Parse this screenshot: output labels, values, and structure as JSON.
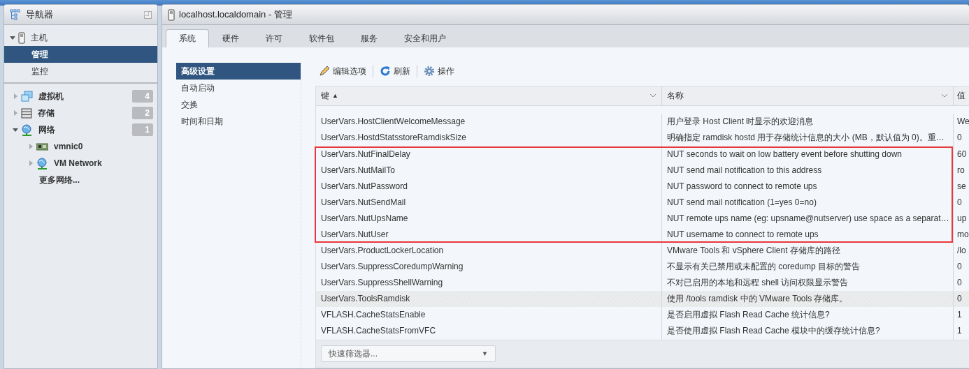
{
  "navigator": {
    "title": "导航器",
    "host": {
      "label": "主机",
      "expanded": true,
      "children": [
        {
          "label": "管理",
          "selected": true
        },
        {
          "label": "监控",
          "selected": false
        }
      ]
    },
    "inventory": [
      {
        "label": "虚拟机",
        "kind": "vm",
        "count": "4",
        "expanded": false
      },
      {
        "label": "存储",
        "kind": "storage",
        "count": "2",
        "expanded": false
      },
      {
        "label": "网络",
        "kind": "network",
        "count": "1",
        "expanded": true,
        "children": [
          {
            "label": "vmnic0",
            "kind": "nic",
            "expanded": false
          },
          {
            "label": "VM Network",
            "kind": "network",
            "expanded": false
          },
          {
            "label": "更多网络...",
            "kind": "more"
          }
        ]
      }
    ]
  },
  "main": {
    "title": "localhost.localdomain - 管理",
    "tabs": [
      {
        "label": "系统",
        "selected": true
      },
      {
        "label": "硬件",
        "selected": false
      },
      {
        "label": "许可",
        "selected": false
      },
      {
        "label": "软件包",
        "selected": false
      },
      {
        "label": "服务",
        "selected": false
      },
      {
        "label": "安全和用户",
        "selected": false
      }
    ],
    "side_menu": [
      {
        "label": "高级设置",
        "selected": true
      },
      {
        "label": "自动启动",
        "selected": false
      },
      {
        "label": "交换",
        "selected": false
      },
      {
        "label": "时间和日期",
        "selected": false
      }
    ],
    "toolbar": [
      {
        "label": "编辑选项",
        "kind": "edit"
      },
      {
        "label": "刷新",
        "kind": "refresh"
      },
      {
        "label": "操作",
        "kind": "actions"
      }
    ],
    "table": {
      "columns": [
        {
          "label": "键",
          "sort": "▲"
        },
        {
          "label": "名称"
        },
        {
          "label": "值"
        }
      ],
      "rows": [
        {
          "key": "UserVars.HostClientWelcomeMessage",
          "name": "用户登录 Host Client 时显示的欢迎消息",
          "value": "We",
          "selected": false,
          "highlighted": false
        },
        {
          "key": "UserVars.HostdStatsstoreRamdiskSize",
          "name": "明确指定 ramdisk hostd 用于存储统计信息的大小 (MB，默认值为 0)。重…",
          "value": "0",
          "selected": false,
          "highlighted": false
        },
        {
          "key": "UserVars.NutFinalDelay",
          "name": "NUT seconds to wait on low battery event before shutting down",
          "value": "60",
          "selected": false,
          "highlighted": true
        },
        {
          "key": "UserVars.NutMailTo",
          "name": "NUT send mail notification to this address",
          "value": "ro",
          "selected": false,
          "highlighted": true
        },
        {
          "key": "UserVars.NutPassword",
          "name": "NUT password to connect to remote ups",
          "value": "se",
          "selected": false,
          "highlighted": true
        },
        {
          "key": "UserVars.NutSendMail",
          "name": "NUT send mail notification (1=yes 0=no)",
          "value": "0",
          "selected": false,
          "highlighted": true
        },
        {
          "key": "UserVars.NutUpsName",
          "name": "NUT remote ups name (eg: upsname@nutserver) use space as a separat…",
          "value": "up",
          "selected": false,
          "highlighted": true
        },
        {
          "key": "UserVars.NutUser",
          "name": "NUT username to connect to remote ups",
          "value": "mo",
          "selected": false,
          "highlighted": true
        },
        {
          "key": "UserVars.ProductLockerLocation",
          "name": "VMware Tools 和 vSphere Client 存储库的路径",
          "value": "/lo",
          "selected": false,
          "highlighted": false
        },
        {
          "key": "UserVars.SuppressCoredumpWarning",
          "name": "不显示有关已禁用或未配置的 coredump 目标的警告",
          "value": "0",
          "selected": false,
          "highlighted": false
        },
        {
          "key": "UserVars.SuppressShellWarning",
          "name": "不对已启用的本地和远程 shell 访问权限显示警告",
          "value": "0",
          "selected": false,
          "highlighted": false
        },
        {
          "key": "UserVars.ToolsRamdisk",
          "name": "使用 /tools ramdisk 中的 VMware Tools 存储库。",
          "value": "0",
          "selected": true,
          "highlighted": false
        },
        {
          "key": "VFLASH.CacheStatsEnable",
          "name": "是否启用虚拟 Flash Read Cache 统计信息?",
          "value": "1",
          "selected": false,
          "highlighted": false
        },
        {
          "key": "VFLASH.CacheStatsFromVFC",
          "name": "是否使用虚拟 Flash Read Cache 模块中的缓存统计信息?",
          "value": "1",
          "selected": false,
          "highlighted": false
        }
      ]
    },
    "quick_filter": {
      "placeholder": "快速筛选器...",
      "caret": "▼"
    }
  }
}
